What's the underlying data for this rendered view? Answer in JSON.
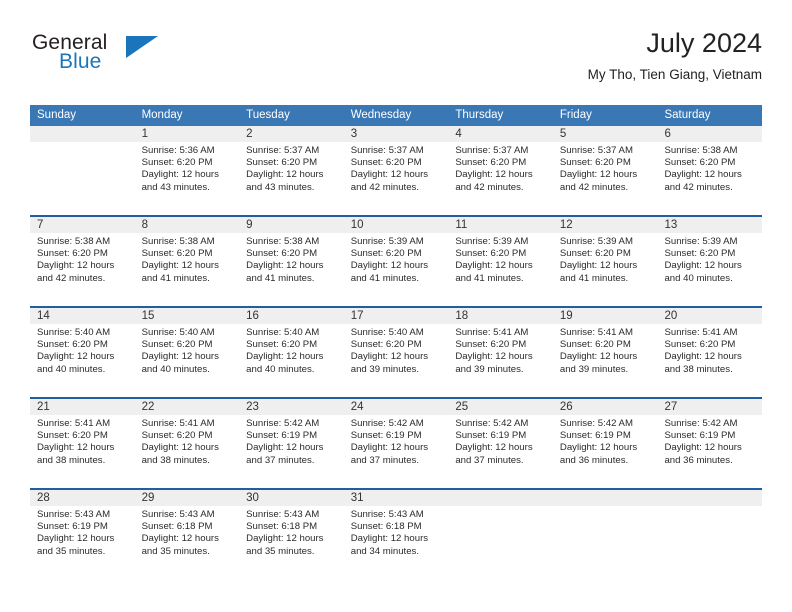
{
  "brand": {
    "name_primary": "General",
    "name_secondary": "Blue",
    "accent_color": "#1b75bb"
  },
  "header": {
    "title": "July 2024",
    "subtitle": "My Tho, Tien Giang, Vietnam",
    "header_bg_color": "#3a77b5",
    "row_divider_color": "#1f5fa0",
    "day_band_color": "#efefef"
  },
  "weekdays": [
    "Sunday",
    "Monday",
    "Tuesday",
    "Wednesday",
    "Thursday",
    "Friday",
    "Saturday"
  ],
  "weeks": [
    [
      {
        "day": "",
        "sunrise": "",
        "sunset": "",
        "daylight1": "",
        "daylight2": "",
        "empty": true
      },
      {
        "day": "1",
        "sunrise": "Sunrise: 5:36 AM",
        "sunset": "Sunset: 6:20 PM",
        "daylight1": "Daylight: 12 hours",
        "daylight2": "and 43 minutes."
      },
      {
        "day": "2",
        "sunrise": "Sunrise: 5:37 AM",
        "sunset": "Sunset: 6:20 PM",
        "daylight1": "Daylight: 12 hours",
        "daylight2": "and 43 minutes."
      },
      {
        "day": "3",
        "sunrise": "Sunrise: 5:37 AM",
        "sunset": "Sunset: 6:20 PM",
        "daylight1": "Daylight: 12 hours",
        "daylight2": "and 42 minutes."
      },
      {
        "day": "4",
        "sunrise": "Sunrise: 5:37 AM",
        "sunset": "Sunset: 6:20 PM",
        "daylight1": "Daylight: 12 hours",
        "daylight2": "and 42 minutes."
      },
      {
        "day": "5",
        "sunrise": "Sunrise: 5:37 AM",
        "sunset": "Sunset: 6:20 PM",
        "daylight1": "Daylight: 12 hours",
        "daylight2": "and 42 minutes."
      },
      {
        "day": "6",
        "sunrise": "Sunrise: 5:38 AM",
        "sunset": "Sunset: 6:20 PM",
        "daylight1": "Daylight: 12 hours",
        "daylight2": "and 42 minutes."
      }
    ],
    [
      {
        "day": "7",
        "sunrise": "Sunrise: 5:38 AM",
        "sunset": "Sunset: 6:20 PM",
        "daylight1": "Daylight: 12 hours",
        "daylight2": "and 42 minutes."
      },
      {
        "day": "8",
        "sunrise": "Sunrise: 5:38 AM",
        "sunset": "Sunset: 6:20 PM",
        "daylight1": "Daylight: 12 hours",
        "daylight2": "and 41 minutes."
      },
      {
        "day": "9",
        "sunrise": "Sunrise: 5:38 AM",
        "sunset": "Sunset: 6:20 PM",
        "daylight1": "Daylight: 12 hours",
        "daylight2": "and 41 minutes."
      },
      {
        "day": "10",
        "sunrise": "Sunrise: 5:39 AM",
        "sunset": "Sunset: 6:20 PM",
        "daylight1": "Daylight: 12 hours",
        "daylight2": "and 41 minutes."
      },
      {
        "day": "11",
        "sunrise": "Sunrise: 5:39 AM",
        "sunset": "Sunset: 6:20 PM",
        "daylight1": "Daylight: 12 hours",
        "daylight2": "and 41 minutes."
      },
      {
        "day": "12",
        "sunrise": "Sunrise: 5:39 AM",
        "sunset": "Sunset: 6:20 PM",
        "daylight1": "Daylight: 12 hours",
        "daylight2": "and 41 minutes."
      },
      {
        "day": "13",
        "sunrise": "Sunrise: 5:39 AM",
        "sunset": "Sunset: 6:20 PM",
        "daylight1": "Daylight: 12 hours",
        "daylight2": "and 40 minutes."
      }
    ],
    [
      {
        "day": "14",
        "sunrise": "Sunrise: 5:40 AM",
        "sunset": "Sunset: 6:20 PM",
        "daylight1": "Daylight: 12 hours",
        "daylight2": "and 40 minutes."
      },
      {
        "day": "15",
        "sunrise": "Sunrise: 5:40 AM",
        "sunset": "Sunset: 6:20 PM",
        "daylight1": "Daylight: 12 hours",
        "daylight2": "and 40 minutes."
      },
      {
        "day": "16",
        "sunrise": "Sunrise: 5:40 AM",
        "sunset": "Sunset: 6:20 PM",
        "daylight1": "Daylight: 12 hours",
        "daylight2": "and 40 minutes."
      },
      {
        "day": "17",
        "sunrise": "Sunrise: 5:40 AM",
        "sunset": "Sunset: 6:20 PM",
        "daylight1": "Daylight: 12 hours",
        "daylight2": "and 39 minutes."
      },
      {
        "day": "18",
        "sunrise": "Sunrise: 5:41 AM",
        "sunset": "Sunset: 6:20 PM",
        "daylight1": "Daylight: 12 hours",
        "daylight2": "and 39 minutes."
      },
      {
        "day": "19",
        "sunrise": "Sunrise: 5:41 AM",
        "sunset": "Sunset: 6:20 PM",
        "daylight1": "Daylight: 12 hours",
        "daylight2": "and 39 minutes."
      },
      {
        "day": "20",
        "sunrise": "Sunrise: 5:41 AM",
        "sunset": "Sunset: 6:20 PM",
        "daylight1": "Daylight: 12 hours",
        "daylight2": "and 38 minutes."
      }
    ],
    [
      {
        "day": "21",
        "sunrise": "Sunrise: 5:41 AM",
        "sunset": "Sunset: 6:20 PM",
        "daylight1": "Daylight: 12 hours",
        "daylight2": "and 38 minutes."
      },
      {
        "day": "22",
        "sunrise": "Sunrise: 5:41 AM",
        "sunset": "Sunset: 6:20 PM",
        "daylight1": "Daylight: 12 hours",
        "daylight2": "and 38 minutes."
      },
      {
        "day": "23",
        "sunrise": "Sunrise: 5:42 AM",
        "sunset": "Sunset: 6:19 PM",
        "daylight1": "Daylight: 12 hours",
        "daylight2": "and 37 minutes."
      },
      {
        "day": "24",
        "sunrise": "Sunrise: 5:42 AM",
        "sunset": "Sunset: 6:19 PM",
        "daylight1": "Daylight: 12 hours",
        "daylight2": "and 37 minutes."
      },
      {
        "day": "25",
        "sunrise": "Sunrise: 5:42 AM",
        "sunset": "Sunset: 6:19 PM",
        "daylight1": "Daylight: 12 hours",
        "daylight2": "and 37 minutes."
      },
      {
        "day": "26",
        "sunrise": "Sunrise: 5:42 AM",
        "sunset": "Sunset: 6:19 PM",
        "daylight1": "Daylight: 12 hours",
        "daylight2": "and 36 minutes."
      },
      {
        "day": "27",
        "sunrise": "Sunrise: 5:42 AM",
        "sunset": "Sunset: 6:19 PM",
        "daylight1": "Daylight: 12 hours",
        "daylight2": "and 36 minutes."
      }
    ],
    [
      {
        "day": "28",
        "sunrise": "Sunrise: 5:43 AM",
        "sunset": "Sunset: 6:19 PM",
        "daylight1": "Daylight: 12 hours",
        "daylight2": "and 35 minutes."
      },
      {
        "day": "29",
        "sunrise": "Sunrise: 5:43 AM",
        "sunset": "Sunset: 6:18 PM",
        "daylight1": "Daylight: 12 hours",
        "daylight2": "and 35 minutes."
      },
      {
        "day": "30",
        "sunrise": "Sunrise: 5:43 AM",
        "sunset": "Sunset: 6:18 PM",
        "daylight1": "Daylight: 12 hours",
        "daylight2": "and 35 minutes."
      },
      {
        "day": "31",
        "sunrise": "Sunrise: 5:43 AM",
        "sunset": "Sunset: 6:18 PM",
        "daylight1": "Daylight: 12 hours",
        "daylight2": "and 34 minutes."
      },
      {
        "day": "",
        "sunrise": "",
        "sunset": "",
        "daylight1": "",
        "daylight2": "",
        "empty": true
      },
      {
        "day": "",
        "sunrise": "",
        "sunset": "",
        "daylight1": "",
        "daylight2": "",
        "empty": true
      },
      {
        "day": "",
        "sunrise": "",
        "sunset": "",
        "daylight1": "",
        "daylight2": "",
        "empty": true
      }
    ]
  ]
}
